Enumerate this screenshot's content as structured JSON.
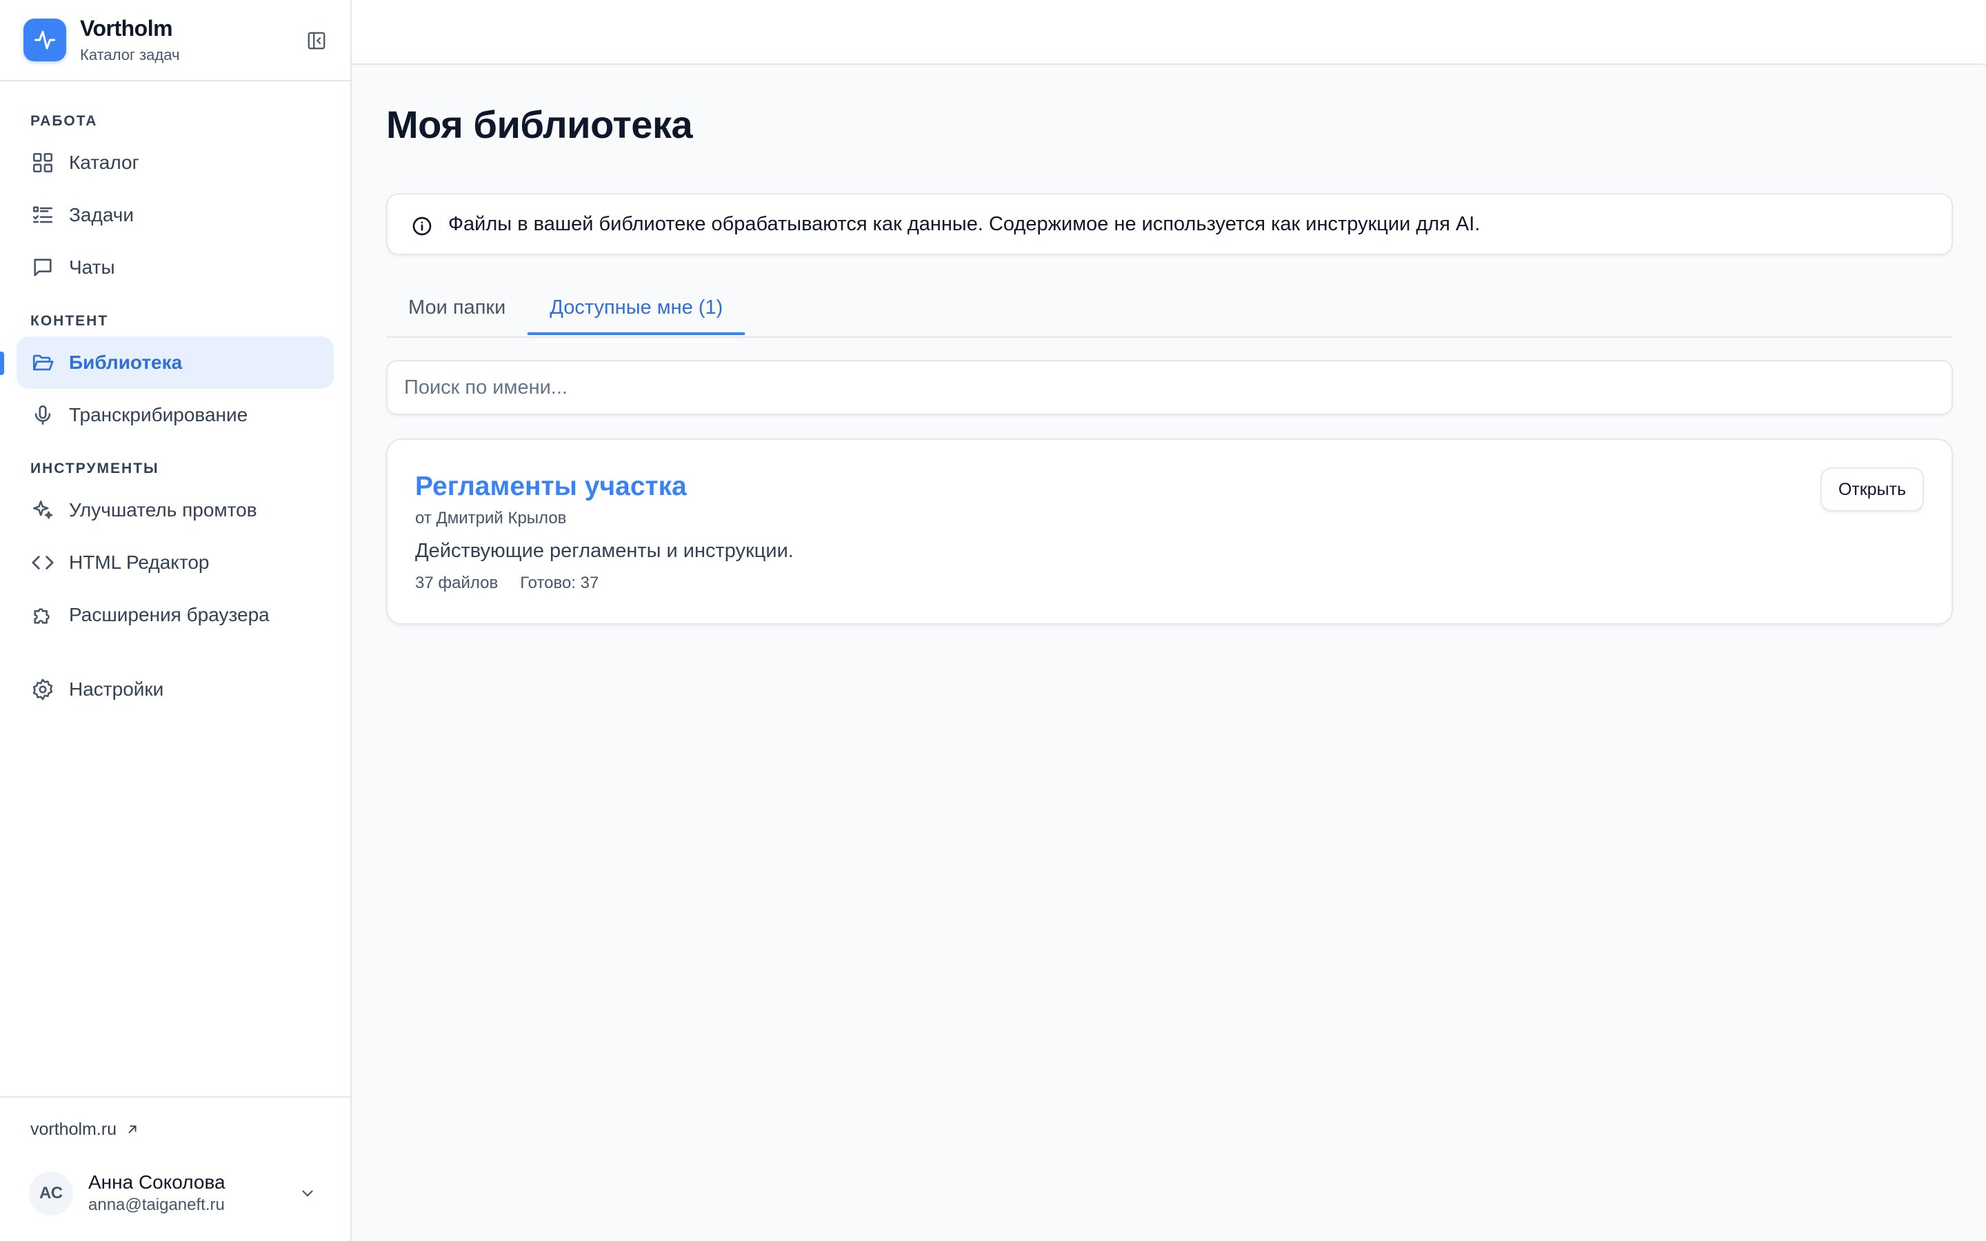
{
  "brand": {
    "name": "Vortholm",
    "subtitle": "Каталог задач"
  },
  "sidebar": {
    "sections": [
      {
        "title": "РАБОТА",
        "items": [
          {
            "label": "Каталог",
            "icon": "grid-icon"
          },
          {
            "label": "Задачи",
            "icon": "list-icon"
          },
          {
            "label": "Чаты",
            "icon": "chat-icon"
          }
        ]
      },
      {
        "title": "КОНТЕНТ",
        "items": [
          {
            "label": "Библиотека",
            "icon": "folder-open-icon",
            "active": true
          },
          {
            "label": "Транскрибирование",
            "icon": "microphone-icon"
          }
        ]
      },
      {
        "title": "ИНСТРУМЕНТЫ",
        "items": [
          {
            "label": "Улучшатель промтов",
            "icon": "sparkles-icon"
          },
          {
            "label": "HTML Редактор",
            "icon": "code-icon"
          },
          {
            "label": "Расширения браузера",
            "icon": "puzzle-icon"
          }
        ]
      }
    ],
    "settings": {
      "label": "Настройки",
      "icon": "gear-icon"
    },
    "site_link": "vortholm.ru",
    "user": {
      "initials": "АС",
      "name": "Анна Соколова",
      "email": "anna@taiganeft.ru"
    }
  },
  "main": {
    "title": "Моя библиотека",
    "notice": "Файлы в вашей библиотеке обрабатываются как данные. Содержимое не используется как инструкции для AI.",
    "tabs": [
      {
        "label": "Мои папки",
        "active": false
      },
      {
        "label": "Доступные мне (1)",
        "active": true
      }
    ],
    "search_placeholder": "Поиск по имени...",
    "folders": [
      {
        "title": "Регламенты участка",
        "owner": "от Дмитрий Крылов",
        "description": "Действующие регламенты и инструкции.",
        "files": "37 файлов",
        "ready": "Готово: 37",
        "open_label": "Открыть"
      }
    ]
  },
  "colors": {
    "accent": "#3b82f6",
    "active_bg": "#e8f0fd",
    "text": "#0f172a",
    "muted": "#475569",
    "border": "#e5e7eb",
    "background": "#f8fafc"
  }
}
